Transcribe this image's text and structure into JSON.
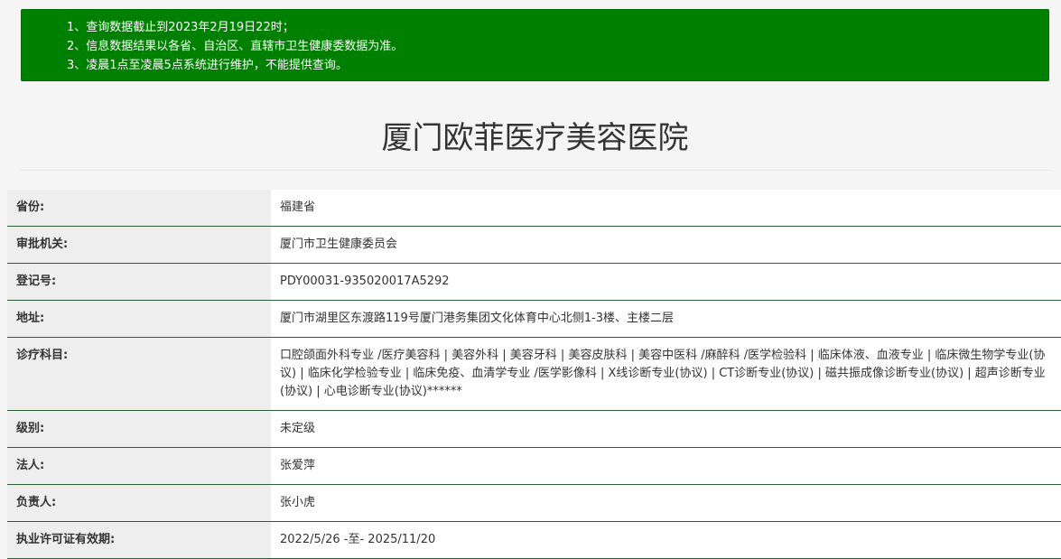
{
  "notice": {
    "lines": [
      "1、查询数据截止到2023年2月19日22时；",
      "2、信息数据结果以各省、自治区、直辖市卫生健康委数据为准。",
      "3、凌晨1点至凌晨5点系统进行维护，不能提供查询。"
    ]
  },
  "page_title": "厦门欧菲医疗美容医院",
  "info_rows": [
    {
      "label": "省份:",
      "value": "福建省"
    },
    {
      "label": "审批机关:",
      "value": "厦门市卫生健康委员会"
    },
    {
      "label": "登记号:",
      "value": "PDY00031-935020017A5292"
    },
    {
      "label": "地址:",
      "value": "厦门市湖里区东渡路119号厦门港务集团文化体育中心北侧1-3楼、主楼二层"
    },
    {
      "label": "诊疗科目:",
      "value": "口腔颌面外科专业 /医疗美容科 | 美容外科 | 美容牙科 | 美容皮肤科 | 美容中医科 /麻醉科 /医学检验科 | 临床体液、血液专业 | 临床微生物学专业(协议) | 临床化学检验专业 | 临床免疫、血清学专业 /医学影像科 | X线诊断专业(协议) | CT诊断专业(协议) | 磁共振成像诊断专业(协议) | 超声诊断专业(协议) | 心电诊断专业(协议)******"
    },
    {
      "label": "级别:",
      "value": "未定级"
    },
    {
      "label": "法人:",
      "value": "张爱萍"
    },
    {
      "label": "负责人:",
      "value": "张小虎"
    },
    {
      "label": "执业许可证有效期:",
      "value": "2022/5/26 -至- 2025/11/20"
    }
  ],
  "colors": {
    "notice_background": "#008000",
    "row_border": "#2f5f3a",
    "label_background": "#eeeeee"
  }
}
